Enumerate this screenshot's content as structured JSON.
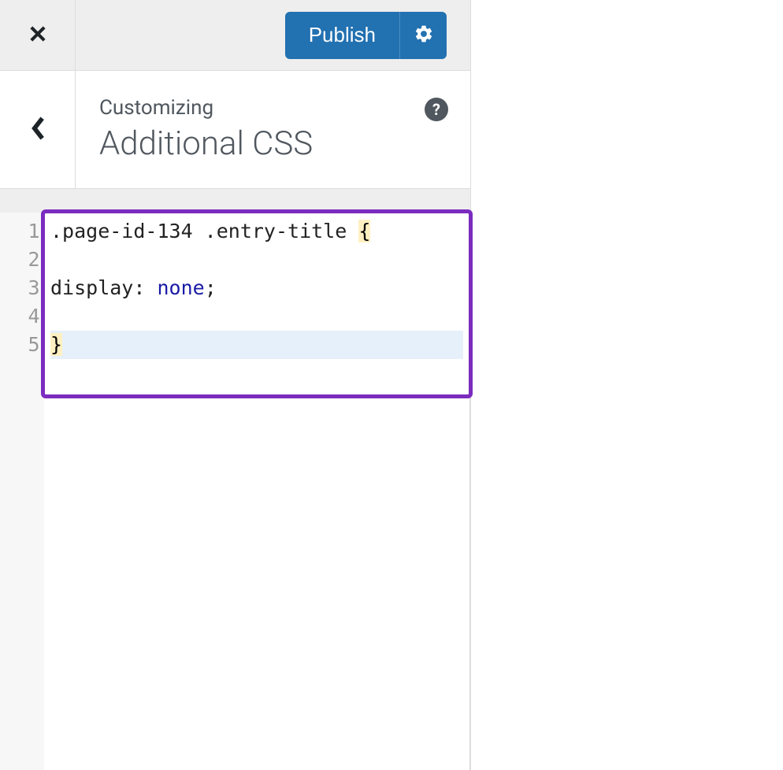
{
  "topbar": {
    "publish_label": "Publish"
  },
  "header": {
    "customizing_label": "Customizing",
    "section_title": "Additional CSS",
    "help_glyph": "?"
  },
  "editor": {
    "gutter": [
      "1",
      "2",
      "3",
      "4",
      "5"
    ],
    "lines": [
      {
        "tokens": [
          {
            "text": ".page-id-134 .entry-title ",
            "cls": "tok-selector"
          },
          {
            "text": "{",
            "cls": "tok-brace"
          }
        ]
      },
      {
        "tokens": []
      },
      {
        "tokens": [
          {
            "text": "display",
            "cls": "tok-property"
          },
          {
            "text": ": ",
            "cls": "tok-colon"
          },
          {
            "text": "none",
            "cls": "tok-value"
          },
          {
            "text": ";",
            "cls": "tok-punct"
          }
        ]
      },
      {
        "tokens": []
      },
      {
        "highlighted": true,
        "tokens": [
          {
            "text": "}",
            "cls": "tok-brace"
          }
        ]
      }
    ],
    "highlight_color": "#7b2cbf"
  }
}
